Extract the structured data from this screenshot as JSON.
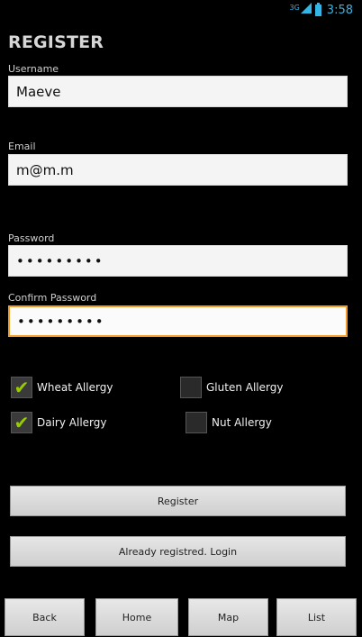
{
  "status_bar": {
    "network": "3G",
    "time": "3:58"
  },
  "page_title": "REGISTER",
  "form": {
    "username": {
      "label": "Username",
      "value": "Maeve"
    },
    "email": {
      "label": "Email",
      "value": "m@m.m"
    },
    "password": {
      "label": "Password",
      "value": "•••••••••"
    },
    "confirm_password": {
      "label": "Confirm Password",
      "value": "•••••••••"
    }
  },
  "allergies": [
    {
      "label": "Wheat Allergy",
      "checked": true
    },
    {
      "label": "Gluten Allergy",
      "checked": false
    },
    {
      "label": "Dairy Allergy",
      "checked": true
    },
    {
      "label": "Nut Allergy",
      "checked": false
    }
  ],
  "buttons": {
    "register": "Register",
    "login": "Already registred. Login"
  },
  "nav": {
    "back": "Back",
    "home": "Home",
    "map": "Map",
    "list": "List"
  },
  "colors": {
    "focus_border": "#f39a2a",
    "check_mark": "#99cc00",
    "status_accent": "#33b5e5"
  }
}
